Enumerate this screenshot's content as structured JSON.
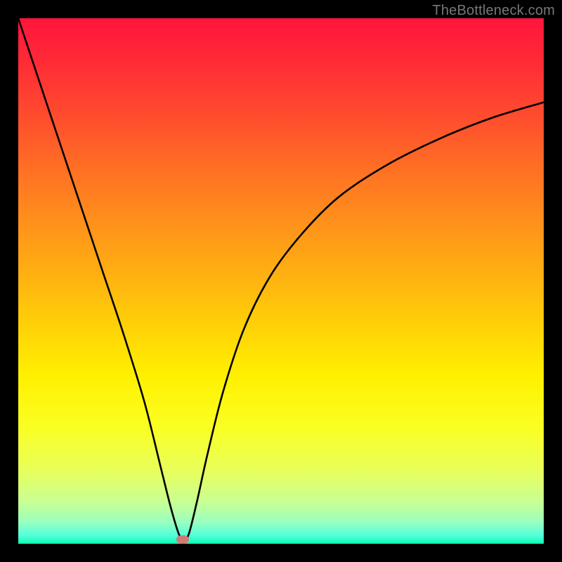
{
  "watermark": "TheBottleneck.com",
  "colors": {
    "frame": "#000000",
    "curve": "#000000",
    "dot": "#cf7a73",
    "gradient_top": "#ff153b",
    "gradient_bottom": "#0bffad"
  },
  "chart_data": {
    "type": "line",
    "title": "",
    "xlabel": "",
    "ylabel": "",
    "xlim": [
      0,
      100
    ],
    "ylim": [
      0,
      100
    ],
    "series": [
      {
        "name": "bottleneck-curve",
        "x": [
          0,
          4,
          8,
          12,
          16,
          20,
          24,
          27,
          29,
          30.5,
          31.5,
          32.5,
          34,
          36,
          39,
          43,
          48,
          54,
          61,
          70,
          80,
          90,
          100
        ],
        "y": [
          100,
          88,
          76,
          64,
          52,
          40,
          27,
          15,
          7,
          2,
          0.5,
          2,
          8,
          17,
          29,
          41,
          51,
          59,
          66,
          72,
          77,
          81,
          84
        ]
      }
    ],
    "marker": {
      "x": 31.3,
      "y": 0.8
    }
  }
}
